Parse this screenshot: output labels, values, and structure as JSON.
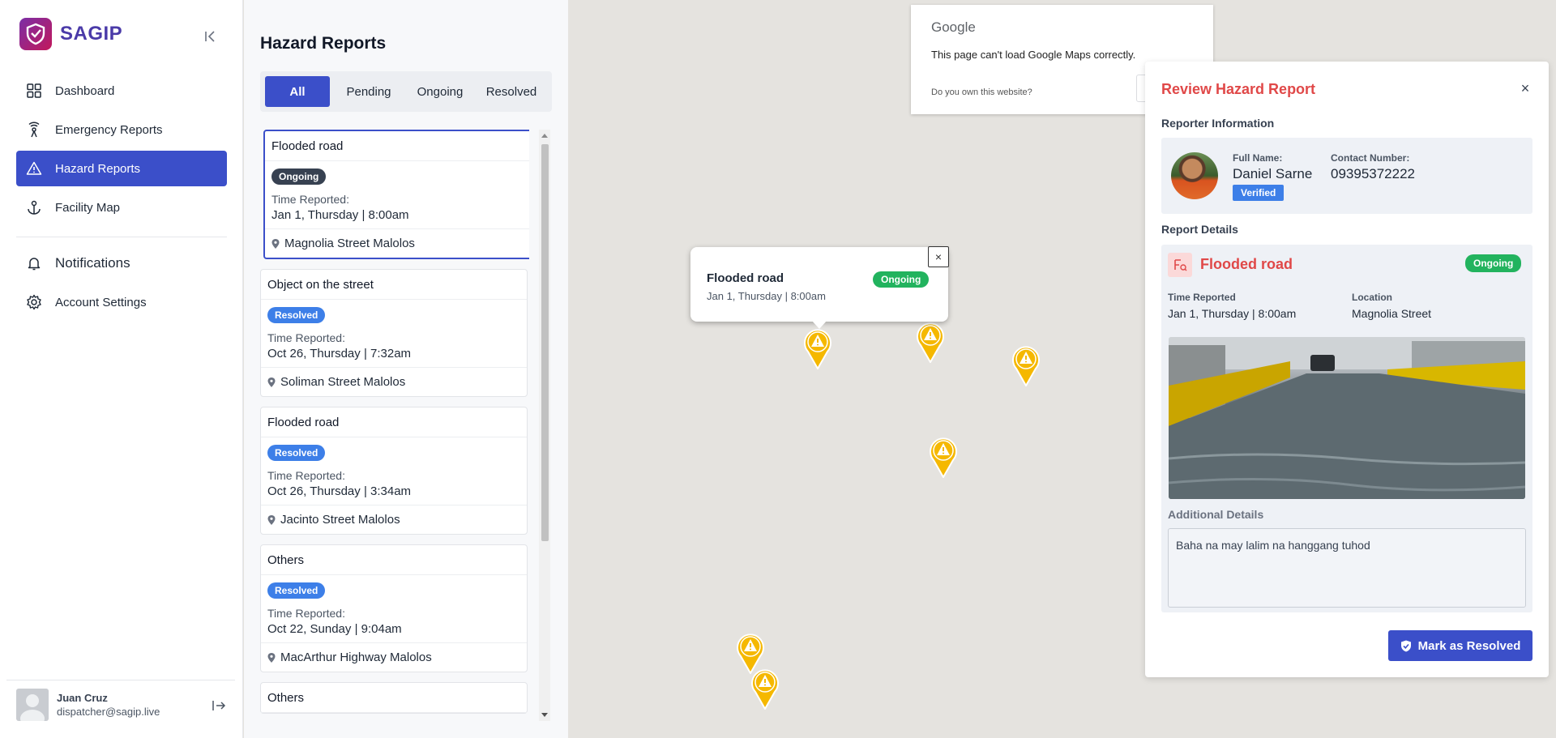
{
  "brand": {
    "name": "SAGIP"
  },
  "sidebar": {
    "items": [
      {
        "label": "Dashboard",
        "icon": "grid-icon"
      },
      {
        "label": "Emergency Reports",
        "icon": "signal-icon"
      },
      {
        "label": "Hazard Reports",
        "icon": "warning-icon",
        "active": true
      },
      {
        "label": "Facility Map",
        "icon": "anchor-icon"
      }
    ],
    "secondary": [
      {
        "label": "Notifications",
        "icon": "bell-icon"
      },
      {
        "label": "Account Settings",
        "icon": "gear-icon"
      }
    ],
    "user": {
      "name": "Juan Cruz",
      "email": "dispatcher@sagip.live"
    }
  },
  "list": {
    "title": "Hazard Reports",
    "filters": [
      "All",
      "Pending",
      "Ongoing",
      "Resolved"
    ],
    "active_filter": "All",
    "time_label": "Time Reported:",
    "cards": [
      {
        "title": "Flooded road",
        "status": "Ongoing",
        "time": "Jan 1, Thursday | 8:00am",
        "location": "Magnolia Street Malolos"
      },
      {
        "title": "Object on the street",
        "status": "Resolved",
        "time": "Oct 26, Thursday | 7:32am",
        "location": "Soliman Street Malolos"
      },
      {
        "title": "Flooded road",
        "status": "Resolved",
        "time": "Oct 26, Thursday | 3:34am",
        "location": "Jacinto Street Malolos"
      },
      {
        "title": "Others",
        "status": "Resolved",
        "time": "Oct 22, Sunday | 9:04am",
        "location": "MacArthur Highway Malolos"
      },
      {
        "title": "Others"
      }
    ]
  },
  "gmaps": {
    "logo": "Google",
    "message": "This page can't load Google Maps correctly.",
    "own_site": "Do you own this website?"
  },
  "infowindow": {
    "title": "Flooded road",
    "time": "Jan 1, Thursday | 8:00am",
    "status": "Ongoing",
    "close": "×"
  },
  "review": {
    "title": "Review Hazard Report",
    "close": "×",
    "reporter_section": "Reporter Information",
    "full_name_label": "Full Name:",
    "full_name": "Daniel Sarne",
    "contact_label": "Contact Number:",
    "contact": "09395372222",
    "verified": "Verified",
    "details_section": "Report Details",
    "hazard": "Flooded road",
    "status": "Ongoing",
    "time_label": "Time Reported",
    "time": "Jan 1, Thursday | 8:00am",
    "location_label": "Location",
    "location": "Magnolia Street",
    "additional_label": "Additional Details",
    "additional": "Baha na may lalim na hanggang tuhod",
    "resolve_button": "Mark as Resolved"
  },
  "colors": {
    "primary": "#3b4fc9",
    "ongoing_dark": "#374151",
    "resolved": "#3d7fe8",
    "ongoing_green": "#22b35e",
    "danger": "#e04848",
    "marker": "#f5b800"
  }
}
